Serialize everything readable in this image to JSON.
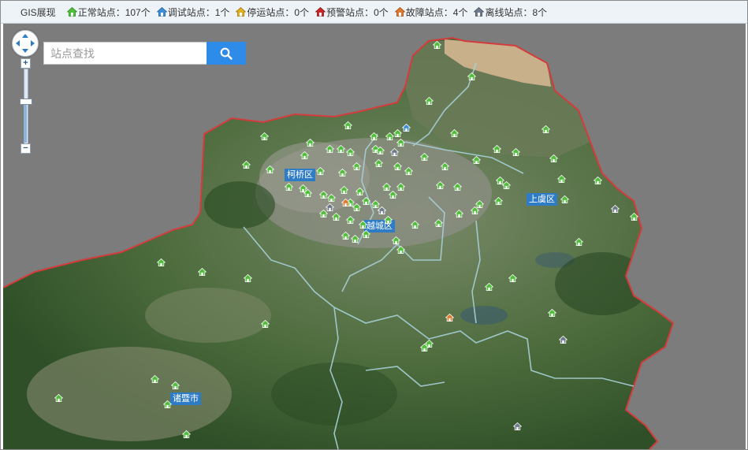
{
  "topbar": {
    "title": "GIS展现",
    "stats": [
      {
        "label": "正常站点：107个",
        "icon": "home-normal-icon",
        "color": "#4fbf3a"
      },
      {
        "label": "调试站点：1个",
        "icon": "home-debug-icon",
        "color": "#3f8fd6"
      },
      {
        "label": "停运站点：0个",
        "icon": "home-stopped-icon",
        "color": "#e0b020"
      },
      {
        "label": "预警站点：0个",
        "icon": "home-warning-icon",
        "color": "#c8282a"
      },
      {
        "label": "故障站点：4个",
        "icon": "home-fault-icon",
        "color": "#e07a30"
      },
      {
        "label": "离线站点：8个",
        "icon": "home-offline-icon",
        "color": "#6f7a8a"
      }
    ]
  },
  "search": {
    "placeholder": "站点查找"
  },
  "districts": {
    "keqiao": "柯桥区",
    "yuecheng": "越城区",
    "shangyu": "上虞区",
    "zhuji": "诸暨市"
  },
  "colors": {
    "boundary": "#d43c3c",
    "search_button": "#2f8be8",
    "district_label": "#2f7cc6"
  }
}
